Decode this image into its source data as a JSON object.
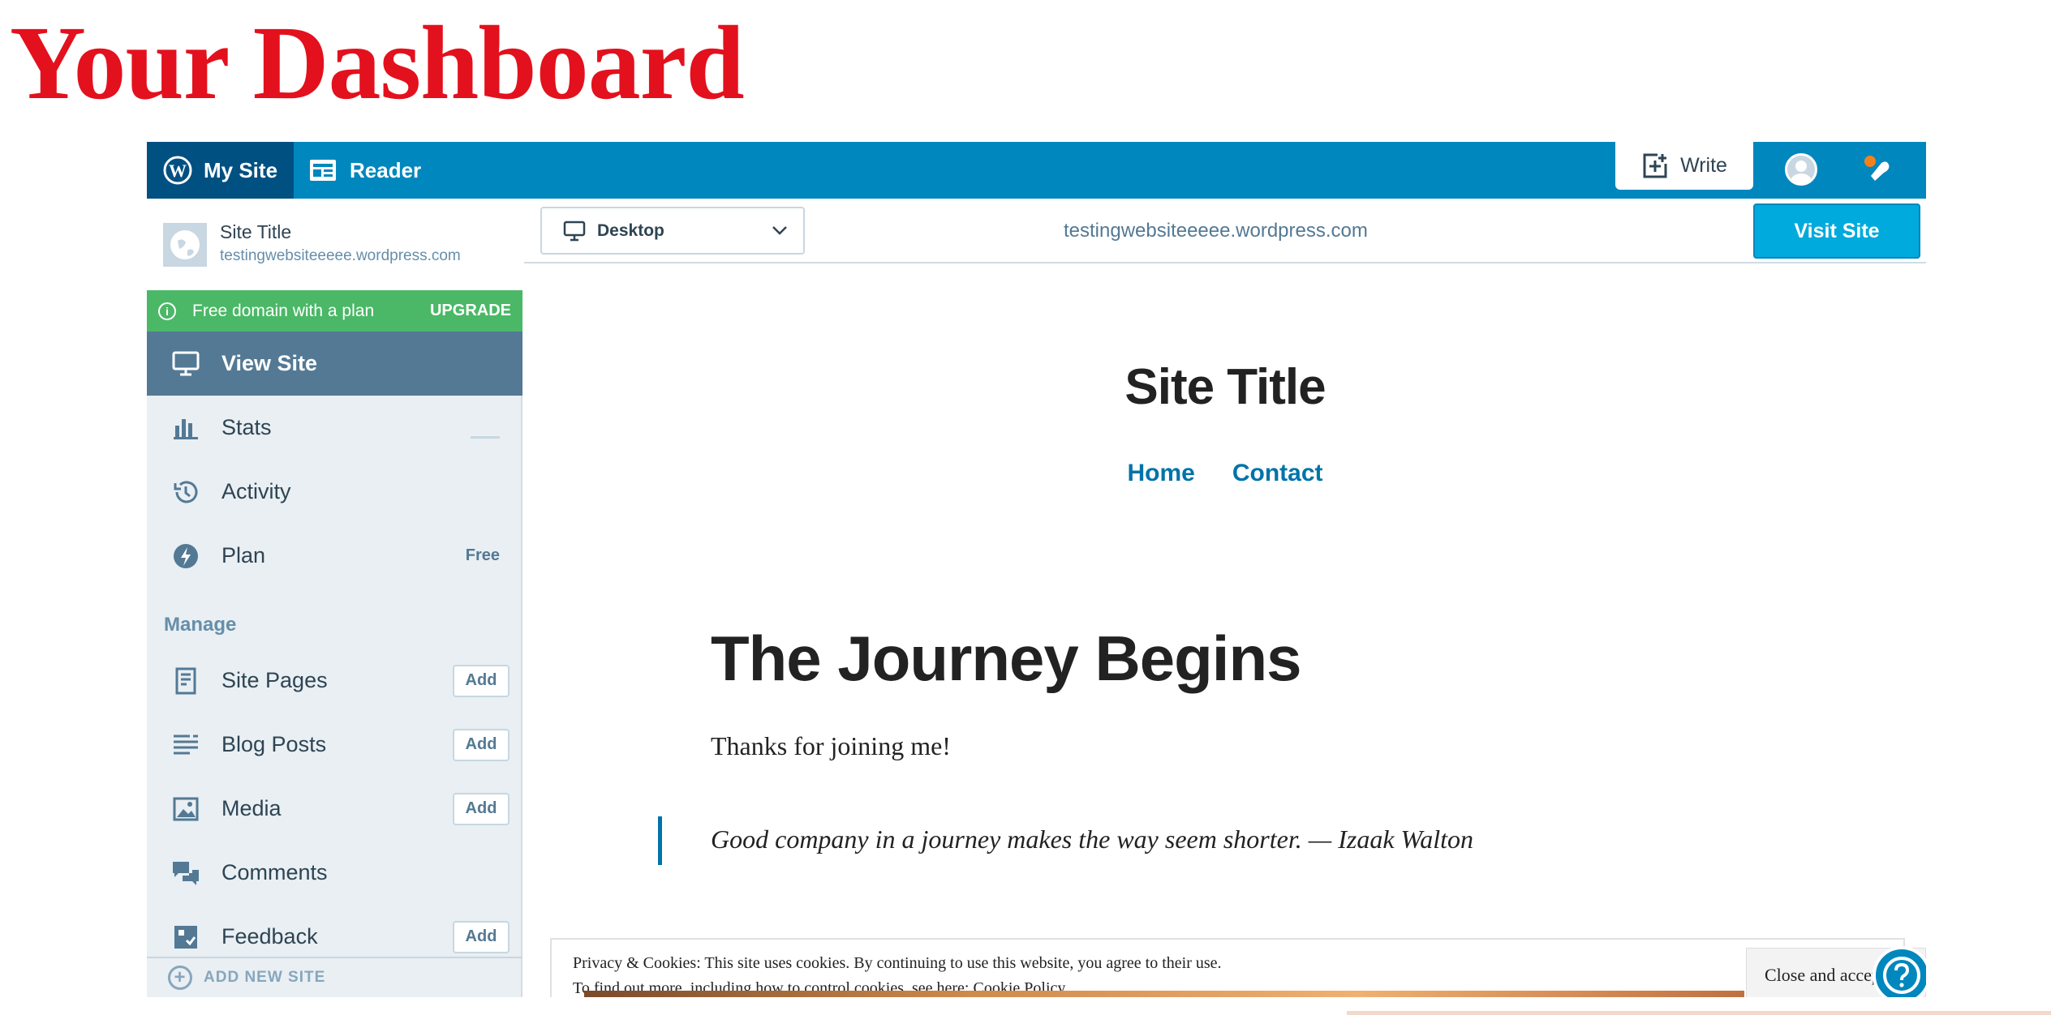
{
  "slide": {
    "title": "Your Dashboard"
  },
  "topbar": {
    "my_site": "My Site",
    "reader": "Reader",
    "write": "Write"
  },
  "sidebar": {
    "site": {
      "name": "Site Title",
      "url": "testingwebsiteeeee.wordpress.com"
    },
    "promo": {
      "text": "Free domain with a plan",
      "action": "UPGRADE"
    },
    "items": [
      {
        "label": "View Site",
        "icon": "monitor-icon"
      },
      {
        "label": "Stats",
        "icon": "bar-chart-icon"
      },
      {
        "label": "Activity",
        "icon": "history-icon"
      },
      {
        "label": "Plan",
        "icon": "plan-bolt-icon",
        "badge": "Free"
      }
    ],
    "manage_header": "Manage",
    "manage_items": [
      {
        "label": "Site Pages",
        "icon": "page-icon",
        "action": "Add"
      },
      {
        "label": "Blog Posts",
        "icon": "posts-icon",
        "action": "Add"
      },
      {
        "label": "Media",
        "icon": "image-icon",
        "action": "Add"
      },
      {
        "label": "Comments",
        "icon": "comments-icon"
      },
      {
        "label": "Feedback",
        "icon": "feedback-icon",
        "action": "Add"
      }
    ],
    "add_new_site": "ADD NEW SITE"
  },
  "preview_bar": {
    "device": "Desktop",
    "url": "testingwebsiteeeee.wordpress.com",
    "visit": "Visit Site"
  },
  "preview": {
    "site_title": "Site Title",
    "nav": [
      "Home",
      "Contact"
    ],
    "post_title": "The Journey Begins",
    "body": "Thanks for joining me!",
    "quote": "Good company in a journey makes the way seem shorter. — Izaak Walton",
    "cookie": {
      "line1": "Privacy & Cookies: This site uses cookies. By continuing to use this website, you agree to their use.",
      "line2": "To find out more, including how to control cookies, see here:",
      "link": "Cookie Policy",
      "close": "Close and accept"
    }
  },
  "colors": {
    "title_red": "#e3111d",
    "masterbar": "#0087be",
    "masterbar_active": "#005082",
    "promo_green": "#4ab866",
    "sidebar_active": "#537994",
    "visit_button": "#00aadc"
  }
}
